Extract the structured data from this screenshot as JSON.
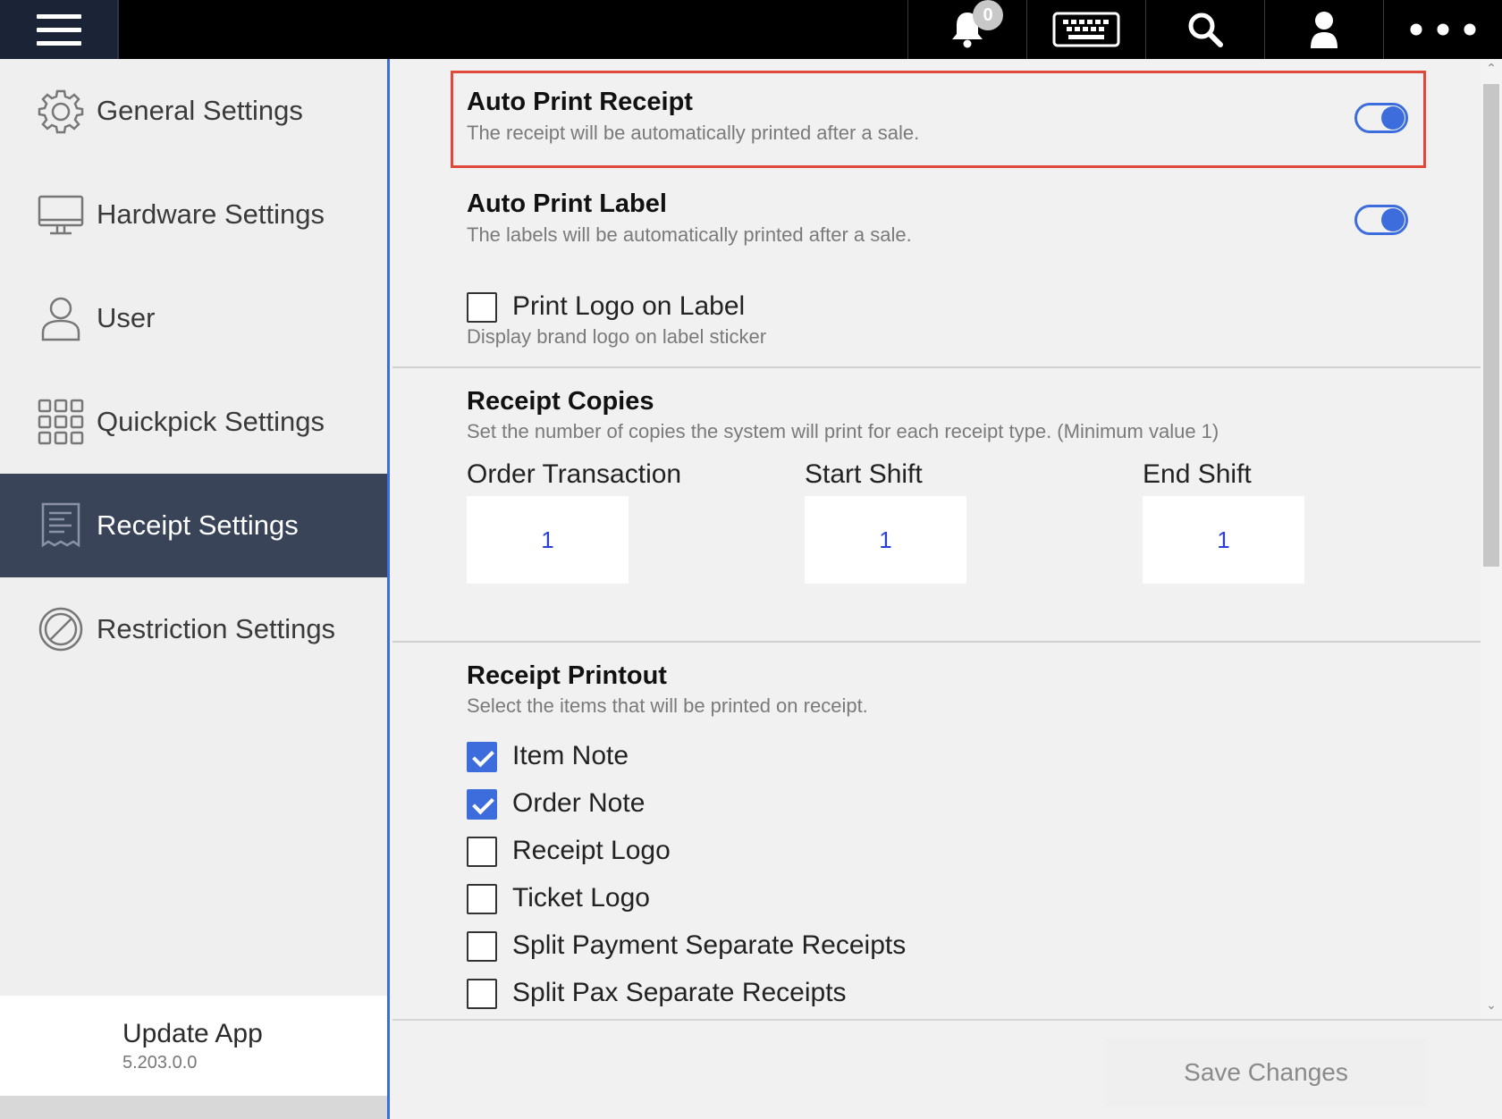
{
  "topbar": {
    "menu_icon": "hamburger-icon",
    "notification_count": "0",
    "icons": [
      "bell-icon",
      "keyboard-icon",
      "search-icon",
      "user-icon",
      "more-icon"
    ]
  },
  "sidebar": {
    "items": [
      {
        "label": "General Settings",
        "icon": "gear-icon",
        "active": false
      },
      {
        "label": "Hardware Settings",
        "icon": "monitor-icon",
        "active": false
      },
      {
        "label": "User",
        "icon": "user-icon",
        "active": false
      },
      {
        "label": "Quickpick Settings",
        "icon": "grid-icon",
        "active": false
      },
      {
        "label": "Receipt Settings",
        "icon": "receipt-icon",
        "active": true
      },
      {
        "label": "Restriction Settings",
        "icon": "restriction-icon",
        "active": false
      }
    ],
    "update": {
      "title": "Update App",
      "version": "5.203.0.0"
    }
  },
  "main": {
    "auto_print_receipt": {
      "title": "Auto Print Receipt",
      "desc": "The receipt will be automatically printed after a sale.",
      "on": true
    },
    "auto_print_label": {
      "title": "Auto Print Label",
      "desc": "The labels will be automatically printed after a sale.",
      "on": true
    },
    "print_logo_label": {
      "label": "Print Logo on Label",
      "desc": "Display brand logo on label sticker",
      "checked": false
    },
    "receipt_copies": {
      "title": "Receipt Copies",
      "desc": "Set the number of copies the system will print for each receipt type. (Minimum value 1)",
      "fields": [
        {
          "label": "Order Transaction",
          "value": "1"
        },
        {
          "label": "Start Shift",
          "value": "1"
        },
        {
          "label": "End Shift",
          "value": "1"
        }
      ]
    },
    "receipt_printout": {
      "title": "Receipt Printout",
      "desc": "Select the items that will be printed on receipt.",
      "options": [
        {
          "label": "Item Note",
          "checked": true
        },
        {
          "label": "Order Note",
          "checked": true
        },
        {
          "label": "Receipt Logo",
          "checked": false
        },
        {
          "label": "Ticket Logo",
          "checked": false
        },
        {
          "label": "Split Payment Separate Receipts",
          "checked": false
        },
        {
          "label": "Split Pax Separate Receipts",
          "checked": false
        }
      ]
    }
  },
  "footer": {
    "save_label": "Save Changes"
  },
  "colors": {
    "accent": "#3d6ddc",
    "highlight": "#e0483a",
    "sidebar_active": "#3a4459",
    "input_value": "#2a3fd6"
  }
}
